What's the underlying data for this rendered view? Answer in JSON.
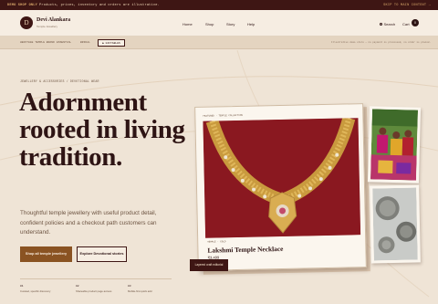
{
  "topbar": {
    "label": "DEMO SHOP ONLY",
    "text": "Products, prices, inventory and orders are illustrative.",
    "skip": "SKIP TO MAIN CONTENT →"
  },
  "brand": {
    "mark": "D",
    "name": "Devi Alankara",
    "tagline": "Temple Jewellery"
  },
  "nav": {
    "items": [
      "Home",
      "Shop",
      "Story",
      "Help"
    ],
    "search": "Search",
    "cart": "Cart",
    "cart_count": "0"
  },
  "crumbs": {
    "items": [
      "HERITAGE TEMPLE BRAND",
      "ESSENTIAL",
      "BRIDAL"
    ],
    "active": "◆ GIFTABLES",
    "note": "Illustrative demo store — no payment is processed, no order is placed."
  },
  "hero": {
    "eyebrow": "JEWELLERY & ACCESSORIES / DEVOTIONAL WEAR",
    "headline": "Adornment rooted in living tradition.",
    "lede": "Thoughtful temple jewellery with useful product detail, confident policies and a checkout path customers can understand.",
    "primary_button": "Shop all temple jewellery",
    "secondary_button": "Explore Devotional stories"
  },
  "features": [
    {
      "num": "01",
      "text": "Curated, specific discovery"
    },
    {
      "num": "02",
      "text": "Shareable product page access"
    },
    {
      "num": "03",
      "text": "Mobile-first quick add"
    }
  ],
  "product_card": {
    "meta": "FEATURED · TEMPLE COLLECTION",
    "category": "TEMPLE · GOLD",
    "title": "Lakshmi Temple Necklace",
    "price": "₹3,499",
    "badge": "Layered craft editorial"
  },
  "colors": {
    "maroon": "#3e1614",
    "accent": "#8a5322",
    "cream": "#efe4d6",
    "necklace_bg": "#8a1820"
  }
}
